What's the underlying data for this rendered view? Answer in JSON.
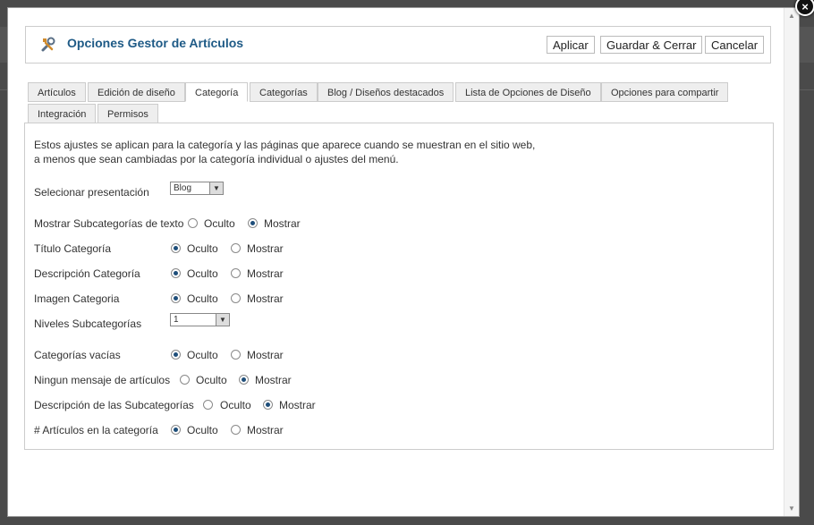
{
  "window": {
    "close_label": "×"
  },
  "toolbar": {
    "icon": "tools-icon",
    "title": "Opciones Gestor de Artículos",
    "apply_label": "Aplicar",
    "save_close_label": "Guardar & Cerrar",
    "cancel_label": "Cancelar"
  },
  "tabs": [
    {
      "label": "Artículos"
    },
    {
      "label": "Edición de diseño"
    },
    {
      "label": "Categoría",
      "active": true
    },
    {
      "label": "Categorías"
    },
    {
      "label": "Blog / Diseños destacados"
    },
    {
      "label": "Lista de Opciones de Diseño"
    },
    {
      "label": "Opciones para compartir"
    },
    {
      "label": "Integración"
    },
    {
      "label": "Permisos"
    }
  ],
  "panel": {
    "intro_line1": "Estos ajustes se aplican para la categoría y las páginas que aparece cuando se muestran en el sitio web,",
    "intro_line2": "a menos que sean cambiadas por la categoría individual o ajustes del menú.",
    "presentation": {
      "label": "Selecionar presentación",
      "value": "Blog"
    },
    "subcat_text": {
      "label": "Mostrar Subcategorías de texto",
      "opt1": "Oculto",
      "opt2": "Mostrar",
      "selected": "Mostrar"
    },
    "cat_title": {
      "label": "Título Categoría",
      "opt1": "Oculto",
      "opt2": "Mostrar",
      "selected": "Oculto"
    },
    "cat_desc": {
      "label": "Descripción Categoría",
      "opt1": "Oculto",
      "opt2": "Mostrar",
      "selected": "Oculto"
    },
    "cat_image": {
      "label": "Imagen Categoria",
      "opt1": "Oculto",
      "opt2": "Mostrar",
      "selected": "Oculto"
    },
    "subcat_levels": {
      "label": "Niveles Subcategorías",
      "value": "1"
    },
    "empty_cats": {
      "label": "Categorías vacías",
      "opt1": "Oculto",
      "opt2": "Mostrar",
      "selected": "Oculto"
    },
    "no_articles_msg": {
      "label": "Ningun mensaje de artículos",
      "opt1": "Oculto",
      "opt2": "Mostrar",
      "selected": "Mostrar"
    },
    "subcat_desc": {
      "label": "Descripción de las Subcategorías",
      "opt1": "Oculto",
      "opt2": "Mostrar",
      "selected": "Mostrar"
    },
    "num_articles": {
      "label": "# Artículos en la categoría",
      "opt1": "Oculto",
      "opt2": "Mostrar",
      "selected": "Oculto"
    }
  },
  "colors": {
    "title": "#1e5a86",
    "radio_checked": "#1e4e7a",
    "overlay": "#3a3a3a"
  }
}
